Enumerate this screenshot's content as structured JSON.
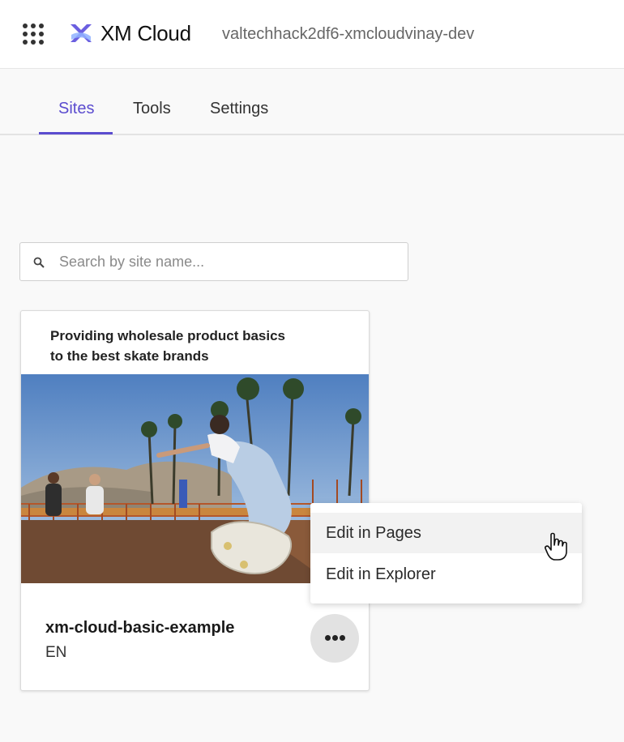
{
  "header": {
    "brand": "XM Cloud",
    "environment": "valtechhack2df6-xmcloudvinay-dev",
    "accent_color": "#5b4ccf"
  },
  "tabs": [
    {
      "label": "Sites",
      "active": true
    },
    {
      "label": "Tools",
      "active": false
    },
    {
      "label": "Settings",
      "active": false
    }
  ],
  "search": {
    "placeholder": "Search by site name...",
    "value": ""
  },
  "card": {
    "tagline": "Providing wholesale product basics to the best skate brands",
    "site_name": "xm-cloud-basic-example",
    "language": "EN"
  },
  "menu": {
    "items": [
      {
        "label": "Edit in Pages"
      },
      {
        "label": "Edit in Explorer"
      }
    ]
  },
  "icons": {
    "app_switcher": "grid-icon",
    "search": "search-icon",
    "more": "more-horizontal-icon",
    "cursor": "hand-pointer-icon"
  }
}
